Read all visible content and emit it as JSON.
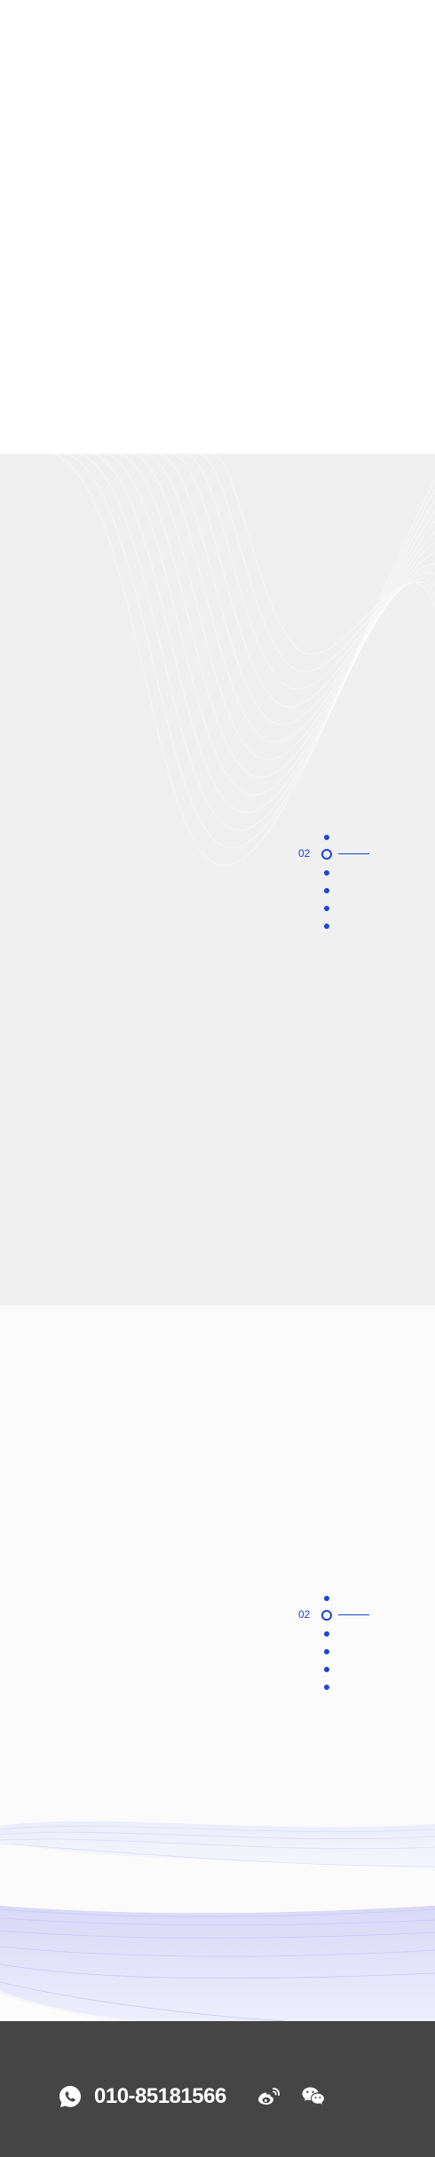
{
  "sections": {
    "first_pager": {
      "current": "02",
      "dot_count": 6,
      "active_index": 1
    },
    "second_pager": {
      "current": "02",
      "dot_count": 6,
      "active_index": 1
    }
  },
  "footer": {
    "phone": "010-85181566",
    "icons": [
      "phone-icon",
      "weibo-icon",
      "wechat-icon"
    ]
  },
  "colors": {
    "accent": "#1c45d4",
    "grey_bg": "#eff0ef",
    "light_bg": "#fbfbfb",
    "footer_bg": "#454545",
    "wave_purple": "#c9c8f5"
  }
}
